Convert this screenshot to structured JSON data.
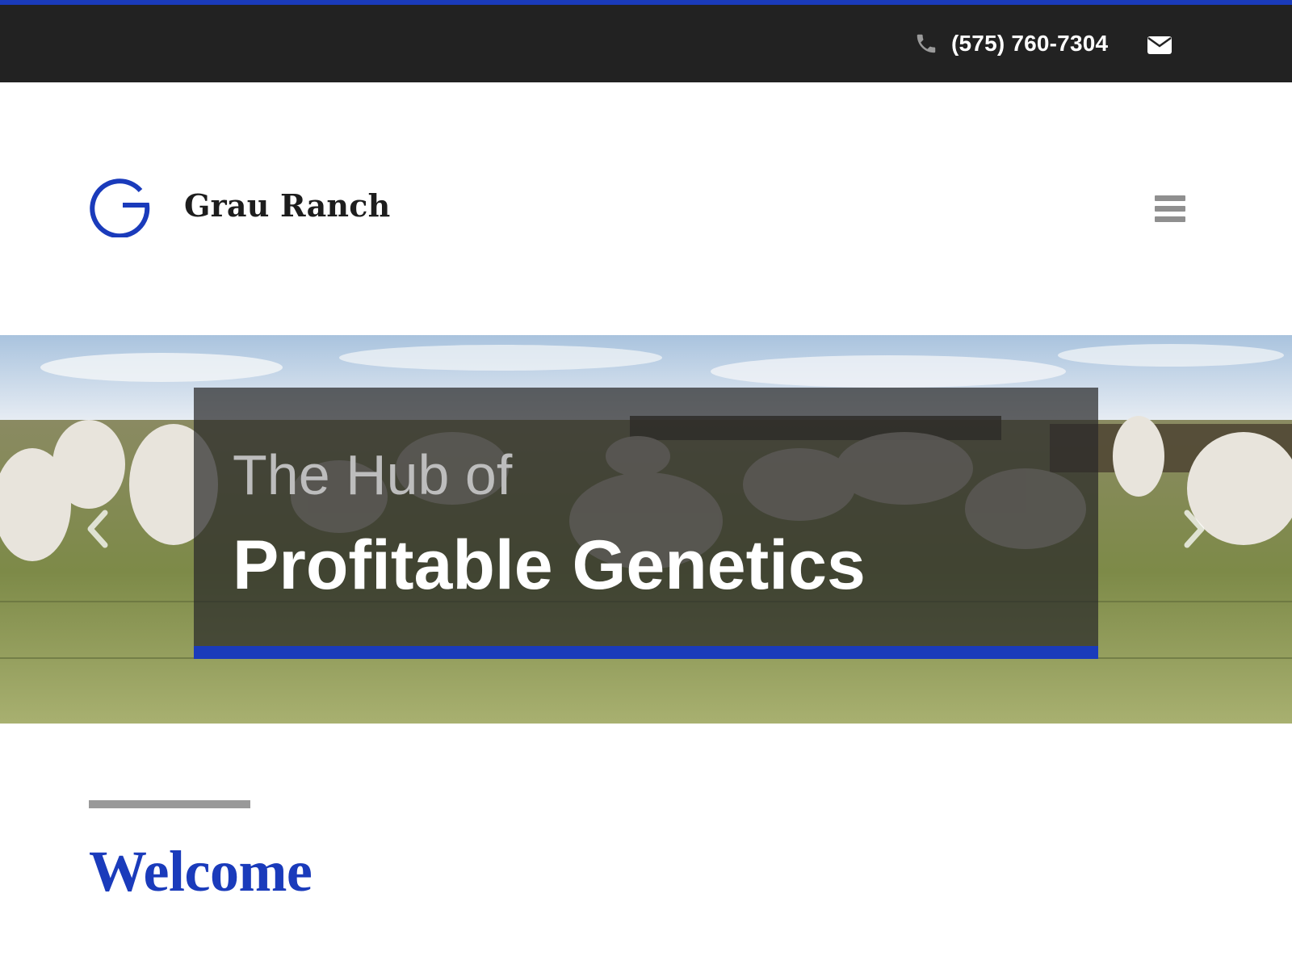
{
  "colors": {
    "accent": "#1a3bbb",
    "topbar_bg": "#222222",
    "menu_icon": "#8f8f8f",
    "divider": "#999999"
  },
  "topbar": {
    "phone_icon": "phone-icon",
    "phone": "(575) 760-7304",
    "email_icon": "envelope-icon"
  },
  "header": {
    "logo_icon": "g-logo-icon",
    "site_name": "Grau Ranch",
    "menu_icon": "hamburger-menu-icon"
  },
  "hero": {
    "caption_line1": "The Hub of",
    "caption_line2": "Profitable Genetics",
    "prev_icon": "chevron-left-icon",
    "next_icon": "chevron-right-icon"
  },
  "main": {
    "heading": "Welcome"
  }
}
